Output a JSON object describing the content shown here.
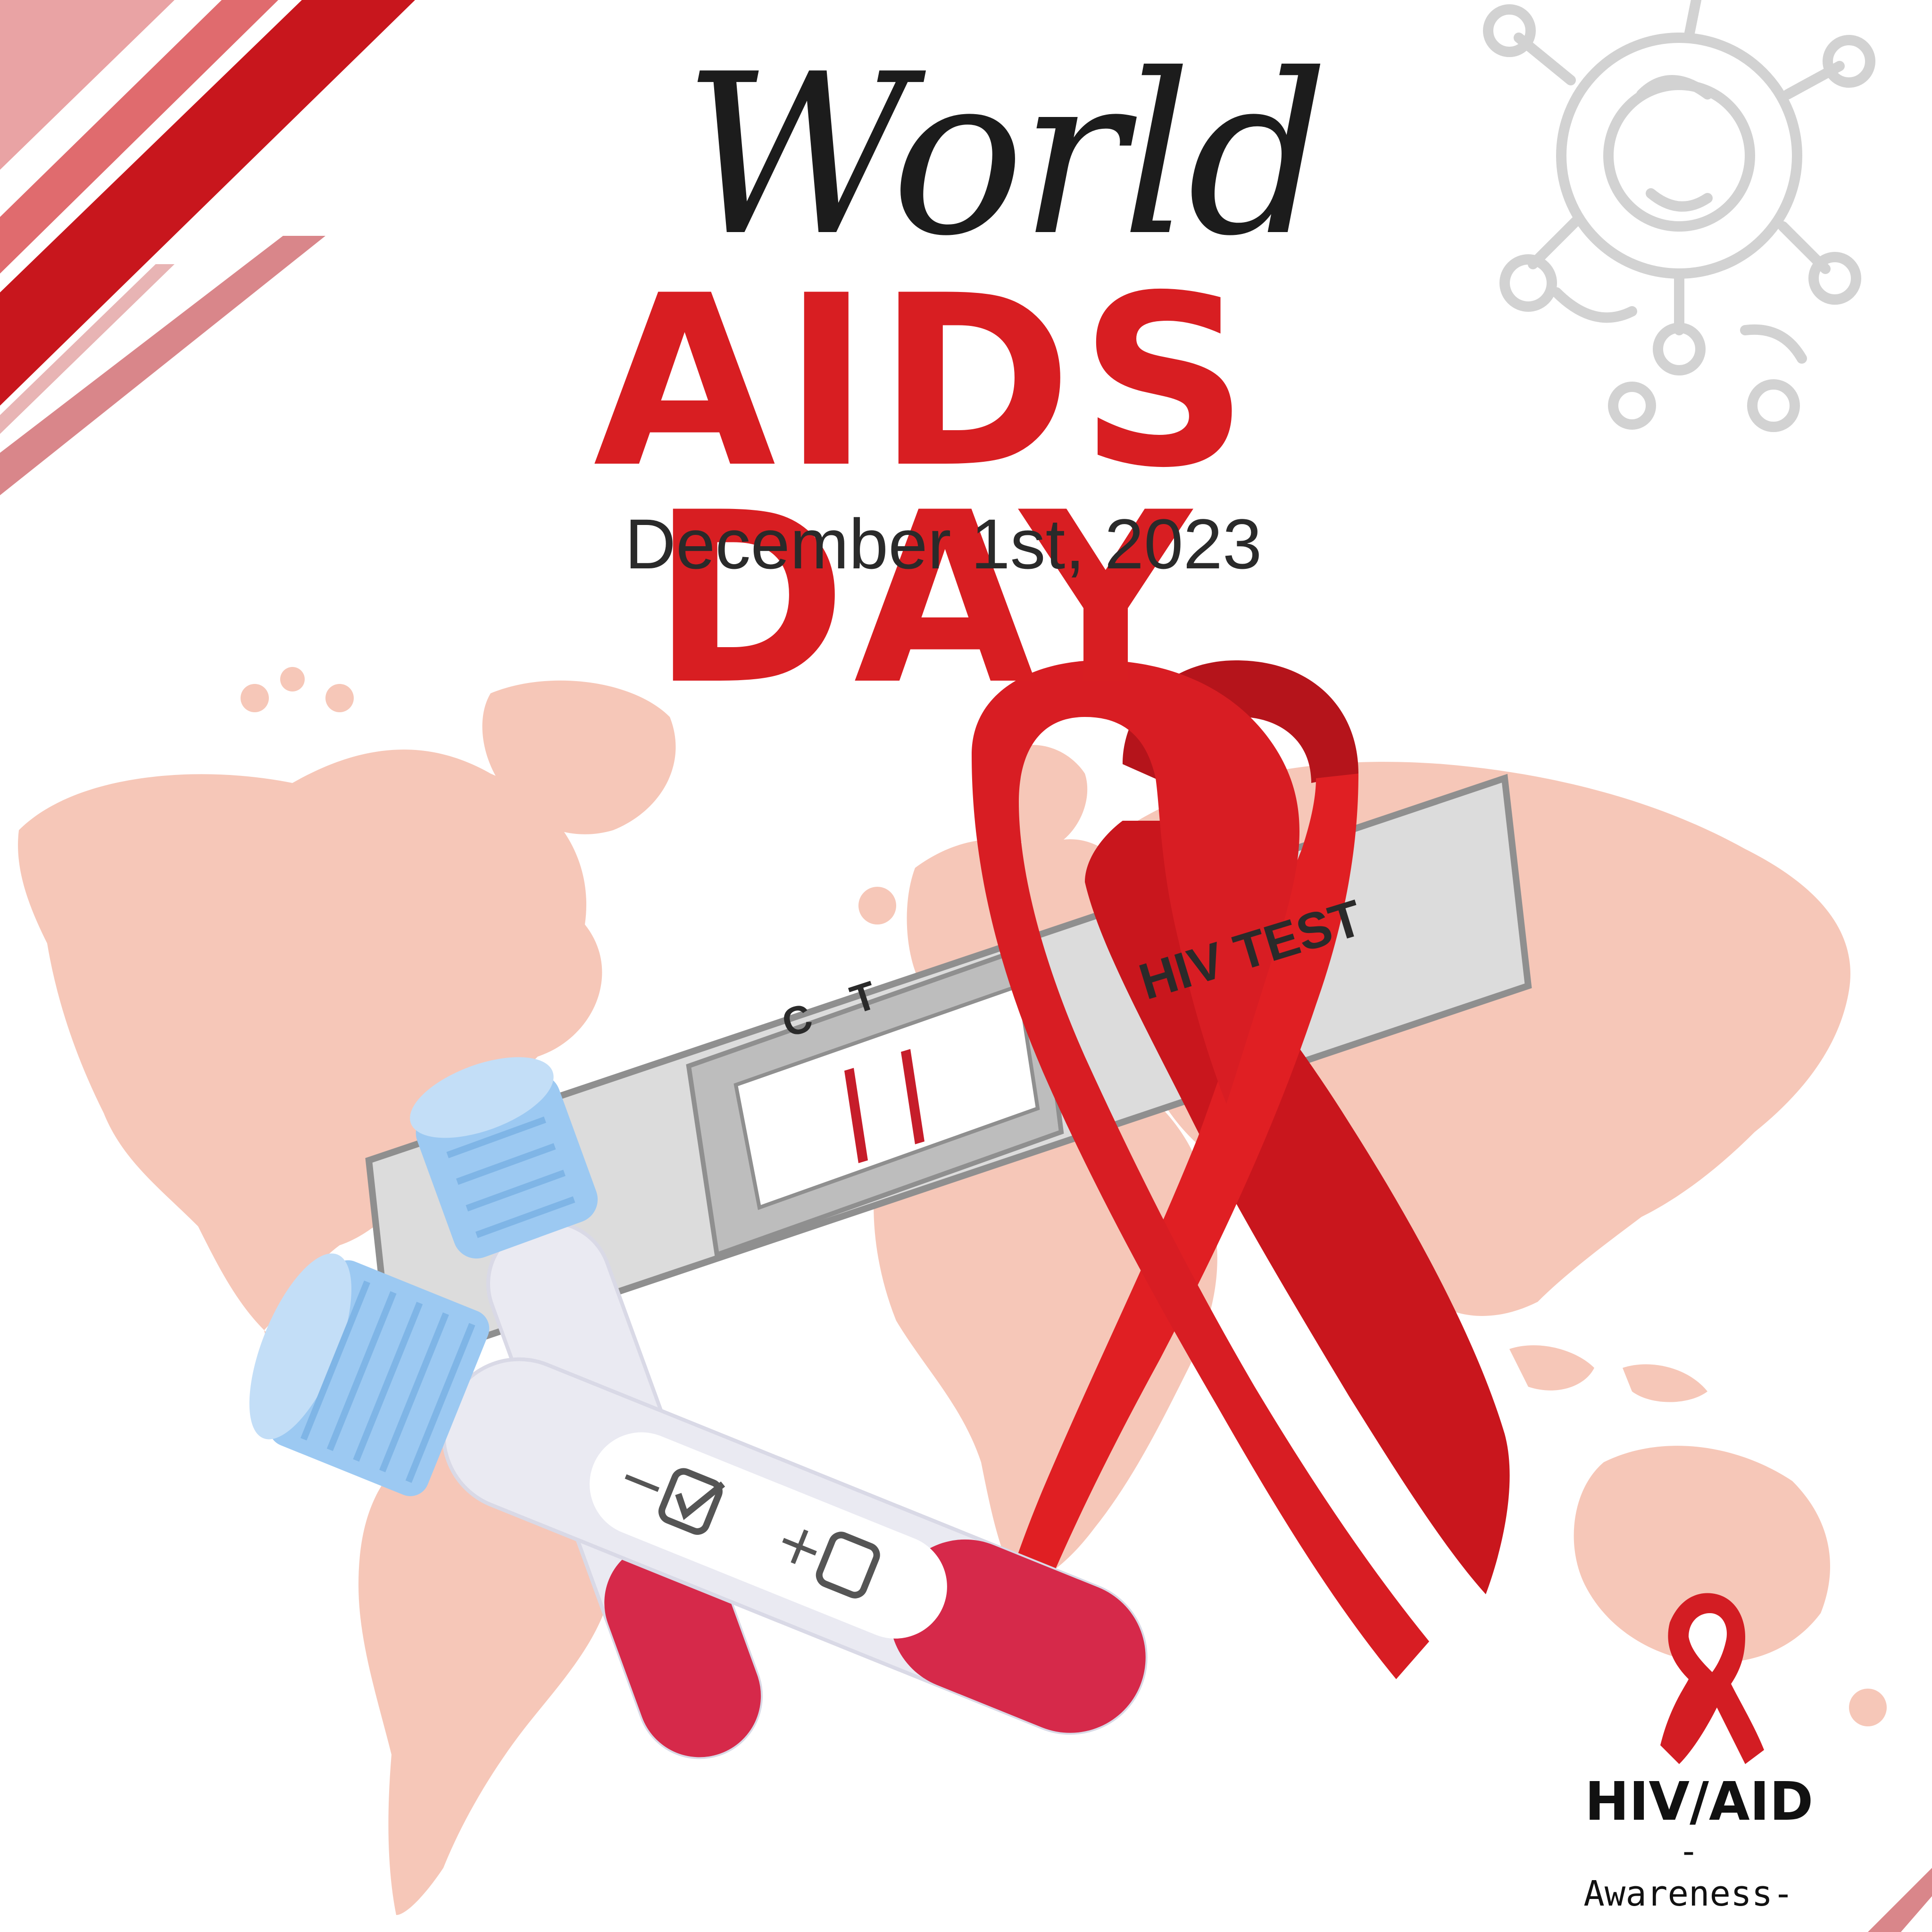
{
  "poster": {
    "script_title": "World",
    "main_title": "AIDS DAY",
    "date": "December 1st, 2023"
  },
  "test_kit": {
    "label": "HIV TEST",
    "control_mark": "C",
    "test_mark": "T"
  },
  "sample_tube": {
    "negative_label": "−",
    "positive_label": "+"
  },
  "logo": {
    "title": "HIV/AID",
    "subtitle": "-Awareness-"
  },
  "colors": {
    "ribbon_red": "#e01f23",
    "title_red": "#d81e22",
    "map_pink": "#f6c7b8",
    "stripe_red": "#c8161d",
    "cap_blue": "#9cc9f2",
    "blood_red": "#d6294a"
  }
}
